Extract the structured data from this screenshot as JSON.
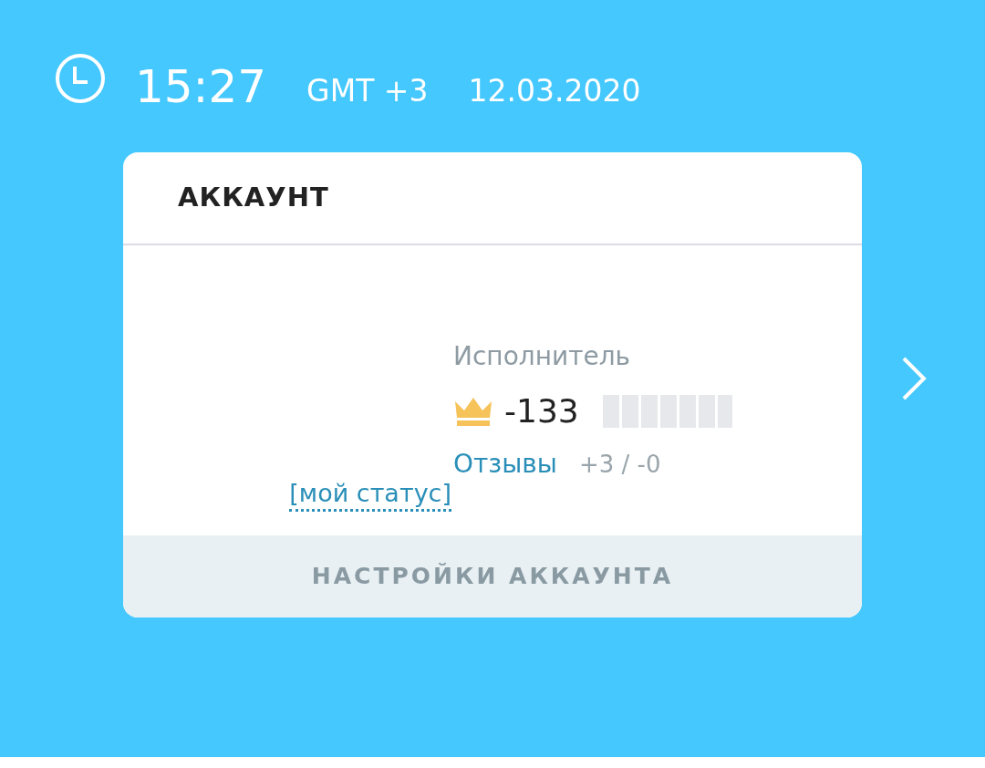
{
  "header": {
    "time": "15:27",
    "timezone": "GMT +3",
    "date": "12.03.2020"
  },
  "card": {
    "title": "АККАУНТ",
    "status_link": "[мой статус]",
    "role": "Исполнитель",
    "rating": "-133",
    "reviews_link": "Отзывы",
    "reviews_count": "+3 / -0",
    "footer_button": "НАСТРОЙКИ АККАУНТА"
  }
}
